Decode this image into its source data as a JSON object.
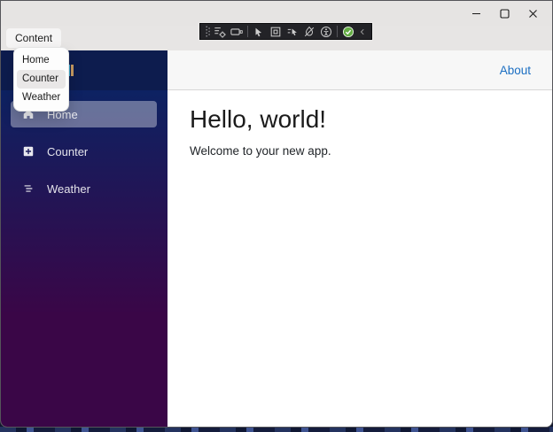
{
  "window": {
    "controls": [
      "minimize",
      "maximize",
      "close"
    ]
  },
  "menubar": {
    "items": [
      {
        "label": "Content"
      }
    ]
  },
  "dropdown": {
    "items": [
      "Home",
      "Counter",
      "Weather"
    ],
    "highlighted_item": "Counter"
  },
  "debug_toolbar": {
    "icons": [
      "grip-handle",
      "live-visual-tree",
      "xaml-live-preview",
      "enable-selection",
      "display-layout-adorners",
      "track-focused-element",
      "hot-reload-disabled",
      "accessibility-checker",
      "hot-reload-status-check",
      "collapse-chevron"
    ]
  },
  "sidebar": {
    "nav": [
      {
        "label": "Home",
        "icon": "house-icon",
        "active": true
      },
      {
        "label": "Counter",
        "icon": "plus-square-icon",
        "active": false
      },
      {
        "label": "Weather",
        "icon": "list-icon",
        "active": false
      }
    ]
  },
  "main": {
    "top_row": {
      "about_label": "About"
    },
    "content": {
      "heading": "Hello, world!",
      "subtitle": "Welcome to your new app."
    }
  },
  "colors": {
    "chrome_bg": "#e7e5e4",
    "brand_band": "#0d1c4e",
    "sidebar_gradient_top": "#052767",
    "sidebar_gradient_bottom": "#3a0647",
    "active_nav_bg": "rgba(255,255,255,0.37)",
    "top_row_bg": "#f7f7f7",
    "about_link": "#1b6ec2",
    "toolbar_bg": "#232327",
    "check_green": "#64ad44"
  }
}
